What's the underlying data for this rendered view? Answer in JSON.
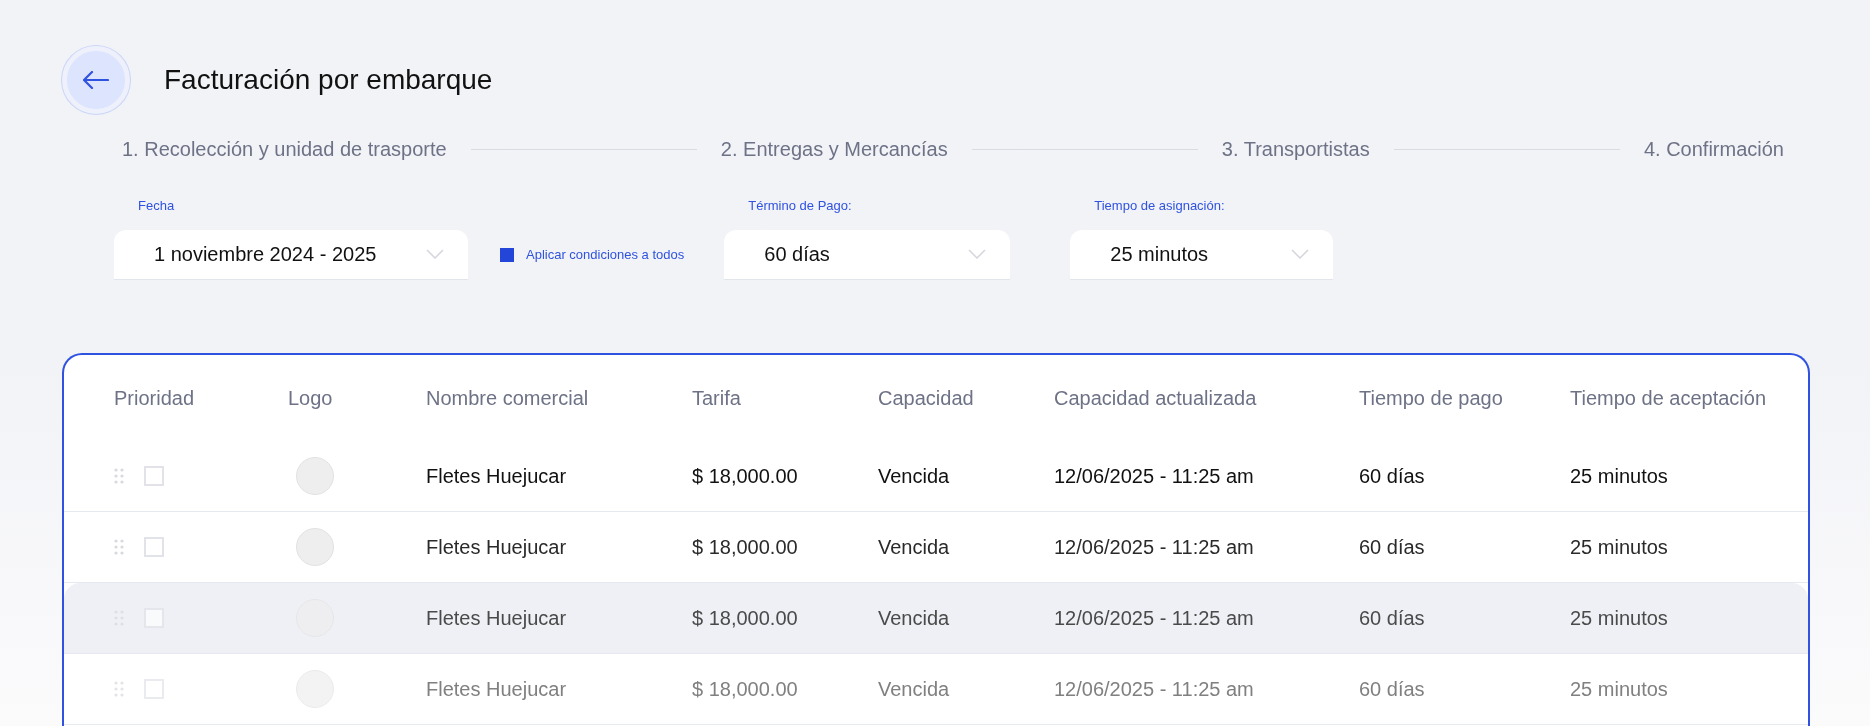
{
  "header": {
    "title": "Facturación por embarque"
  },
  "steps": [
    {
      "label": "1. Recolección y unidad de trasporte"
    },
    {
      "label": "2. Entregas y Mercancías"
    },
    {
      "label": "3. Transportistas"
    },
    {
      "label": "4. Confirmación"
    }
  ],
  "filters": {
    "date": {
      "label": "Fecha",
      "value": "1 noviembre 2024 - 2025"
    },
    "apply_all": {
      "label": "Aplicar condiciones a todos",
      "checked": true
    },
    "payment_term": {
      "label": "Término de Pago:",
      "value": "60 días"
    },
    "assignment_time": {
      "label": "Tiempo de asignación:",
      "value": "25 minutos"
    }
  },
  "table": {
    "columns": [
      "Prioridad",
      "Logo",
      "Nombre comercial",
      "Tarifa",
      "Capacidad",
      "Capacidad actualizada",
      "Tiempo de pago",
      "Tiempo de aceptación"
    ],
    "rows": [
      {
        "checked": false,
        "highlighted": false,
        "name": "Fletes Huejucar",
        "rate": "$ 18,000.00",
        "capacity": "Vencida",
        "updated": "12/06/2025 - 11:25 am",
        "payment": "60 días",
        "acceptance": "25 minutos"
      },
      {
        "checked": false,
        "highlighted": false,
        "name": "Fletes Huejucar",
        "rate": "$ 18,000.00",
        "capacity": "Vencida",
        "updated": "12/06/2025 - 11:25 am",
        "payment": "60 días",
        "acceptance": "25 minutos"
      },
      {
        "checked": false,
        "highlighted": true,
        "name": "Fletes Huejucar",
        "rate": "$ 18,000.00",
        "capacity": "Vencida",
        "updated": "12/06/2025 - 11:25 am",
        "payment": "60 días",
        "acceptance": "25 minutos"
      },
      {
        "checked": false,
        "highlighted": false,
        "name": "Fletes Huejucar",
        "rate": "$ 18,000.00",
        "capacity": "Vencida",
        "updated": "12/06/2025 - 11:25 am",
        "payment": "60 días",
        "acceptance": "25 minutos"
      }
    ]
  }
}
